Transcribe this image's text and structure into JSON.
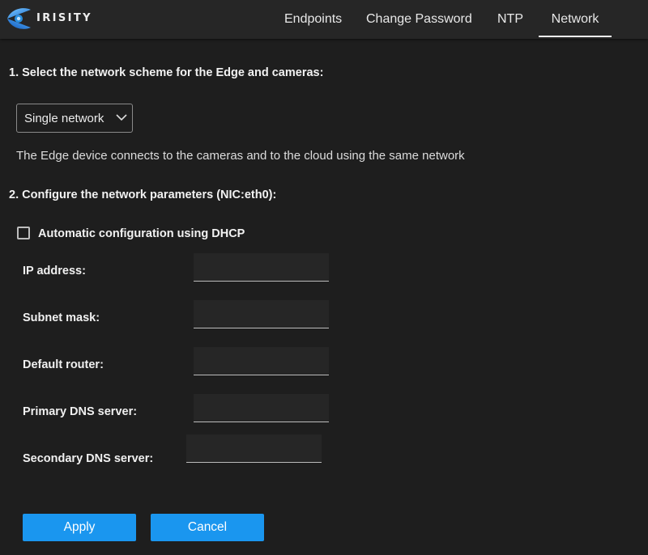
{
  "app": {
    "brand": "IRISITY",
    "logo_icon": "irisity-logo-icon"
  },
  "nav": {
    "tabs": [
      {
        "label": "Endpoints",
        "active": false
      },
      {
        "label": "Change Password",
        "active": false
      },
      {
        "label": "NTP",
        "active": false
      },
      {
        "label": "Network",
        "active": true
      }
    ]
  },
  "section1": {
    "title": "1. Select the network scheme for the Edge and cameras:",
    "scheme_select": {
      "value": "Single network",
      "icon": "chevron-down-icon"
    },
    "description": "The Edge device connects to the cameras and to the cloud using the same network"
  },
  "section2": {
    "title": "2. Configure the network parameters (NIC:eth0):",
    "dhcp": {
      "label": "Automatic configuration using DHCP",
      "checked": false
    },
    "fields": [
      {
        "label": "IP address:",
        "value": ""
      },
      {
        "label": "Subnet mask:",
        "value": ""
      },
      {
        "label": "Default router:",
        "value": ""
      },
      {
        "label": "Primary DNS server:",
        "value": ""
      },
      {
        "label": "Secondary DNS server:",
        "value": ""
      }
    ]
  },
  "actions": {
    "apply_label": "Apply",
    "cancel_label": "Cancel"
  },
  "colors": {
    "background": "#1e1e1e",
    "topbar": "#262626",
    "accent_button": "#1a96ef",
    "logo_blue": "#2a8fe0"
  }
}
